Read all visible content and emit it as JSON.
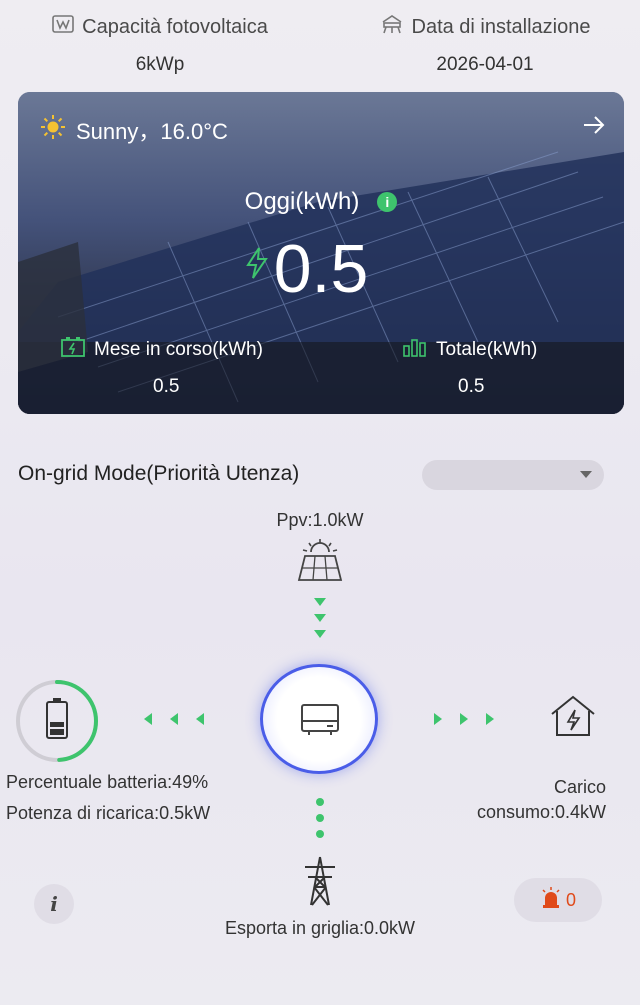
{
  "header": {
    "capacity_label": "Capacità fotovoltaica",
    "capacity_value": "6kWp",
    "install_label": "Data di installazione",
    "install_value": "2026-04-01"
  },
  "hero": {
    "weather": "Sunny，16.0°C",
    "today_label": "Oggi(kWh)",
    "today_value": "0.5",
    "month_label": "Mese in corso(kWh)",
    "month_value": "0.5",
    "total_label": "Totale(kWh)",
    "total_value": "0.5",
    "icons": [
      "sun-icon",
      "arrow-right-icon",
      "info-icon",
      "bolt-icon",
      "battery-charge-icon",
      "bar-chart-icon"
    ]
  },
  "mode": {
    "label": "On-grid Mode(Priorità Utenza)",
    "selector_value": ""
  },
  "flow": {
    "ppv": "Ppv:1.0kW",
    "battery_percent_label": "Percentuale batteria:49%",
    "battery_percent": 49,
    "charge_power": "Potenza di ricarica:0.5kW",
    "load_label": "Carico",
    "load_power": "consumo:0.4kW",
    "grid_export": "Esporta in griglia:0.0kW"
  },
  "footer": {
    "info_label": "i",
    "alarm_count": "0"
  },
  "colors": {
    "accent_green": "#3ec46d",
    "inverter_blue": "#4a5de8",
    "alarm_orange": "#e04a1a"
  }
}
